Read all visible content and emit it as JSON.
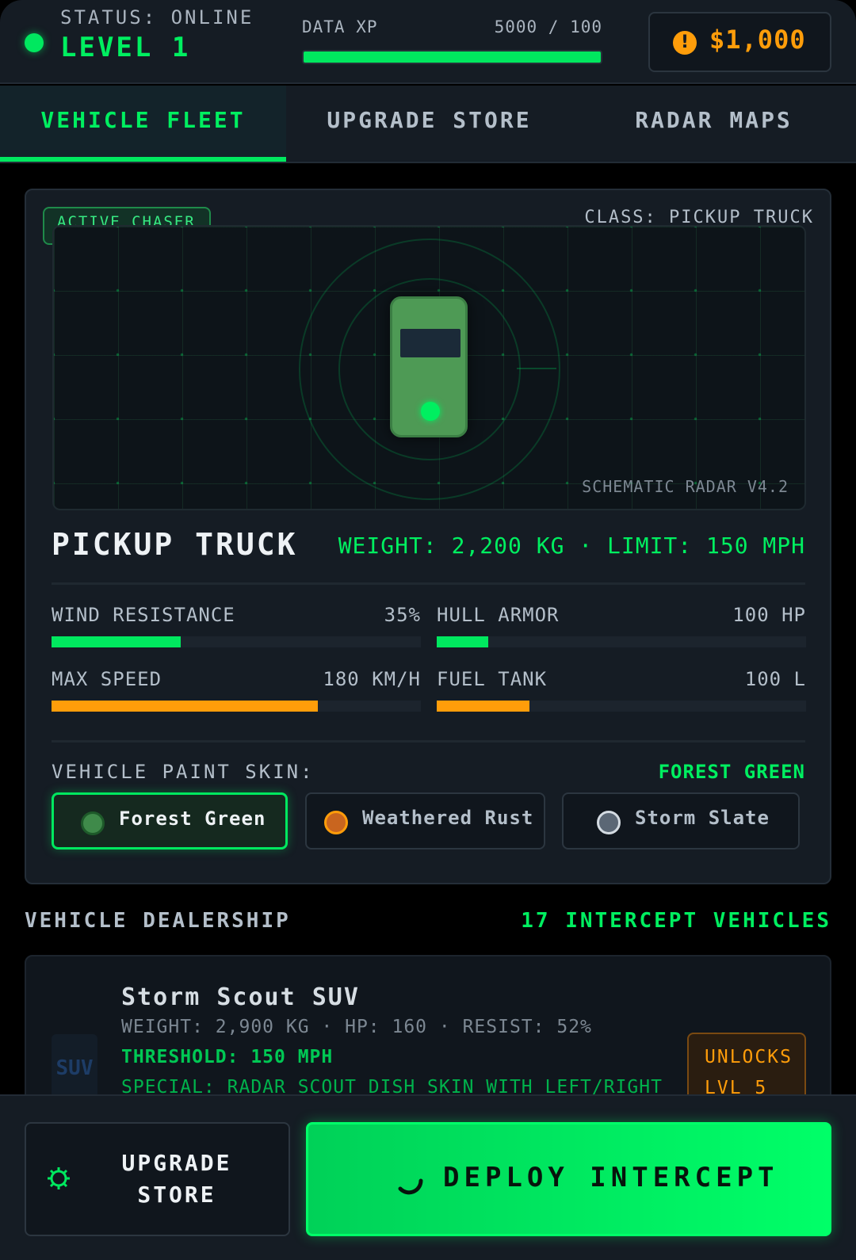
{
  "header": {
    "status": "STATUS: ONLINE",
    "level": "LEVEL 1",
    "xp_label": "DATA XP",
    "xp_value": "5000 / 100",
    "xp_fill_pct": 100,
    "cash": "$1,000"
  },
  "tabs": [
    {
      "label": "VEHICLE FLEET",
      "active": true
    },
    {
      "label": "UPGRADE STORE",
      "active": false
    },
    {
      "label": "RADAR MAPS",
      "active": false
    }
  ],
  "vehicle": {
    "badge": "ACTIVE CHASER",
    "class_label": "CLASS: PICKUP TRUCK",
    "radar_caption": "SCHEMATIC RADAR V4.2",
    "name": "PICKUP TRUCK",
    "specs": "WEIGHT: 2,200 KG · LIMIT: 150 MPH",
    "stats": [
      {
        "label": "WIND RESISTANCE",
        "value": "35%",
        "fill_pct": 35,
        "color": "green"
      },
      {
        "label": "HULL ARMOR",
        "value": "100 HP",
        "fill_pct": 14,
        "color": "green"
      },
      {
        "label": "MAX SPEED",
        "value": "180 KM/H",
        "fill_pct": 72,
        "color": "orange"
      },
      {
        "label": "FUEL TANK",
        "value": "100 L",
        "fill_pct": 25,
        "color": "orange"
      }
    ],
    "skin_label": "VEHICLE PAINT SKIN:",
    "skin_selected": "FOREST GREEN",
    "skins": [
      {
        "name": "Forest Green",
        "swatch_fill": "#3f8a4a",
        "swatch_ring": "#1e5a2a",
        "selected": true
      },
      {
        "name": "Weathered Rust",
        "swatch_fill": "#c9651f",
        "swatch_ring": "#ff9d0a",
        "selected": false
      },
      {
        "name": "Storm Slate",
        "swatch_fill": "#5b6775",
        "swatch_ring": "#d4dbe2",
        "selected": false
      }
    ]
  },
  "dealership": {
    "title": "VEHICLE DEALERSHIP",
    "count": "17 INTERCEPT VEHICLES",
    "items": [
      {
        "thumb": "SUV",
        "name": "Storm Scout SUV",
        "meta": "WEIGHT: 2,900 KG · HP: 160 · RESIST: 52%",
        "threshold": "THRESHOLD: 150 MPH",
        "special": "SPECIAL: RADAR SCOUT DISH SKIN WITH LEFT/RIGHT",
        "unlock_line1": "UNLOCKS",
        "unlock_line2": "LVL 5"
      }
    ]
  },
  "footer": {
    "store_line1": "UPGRADE",
    "store_line2": "STORE",
    "deploy_label": "DEPLOY INTERCEPT"
  },
  "colors": {
    "accent_green": "#00e85f",
    "accent_orange": "#ff9d0a",
    "panel": "#151c24",
    "background": "#000000"
  }
}
